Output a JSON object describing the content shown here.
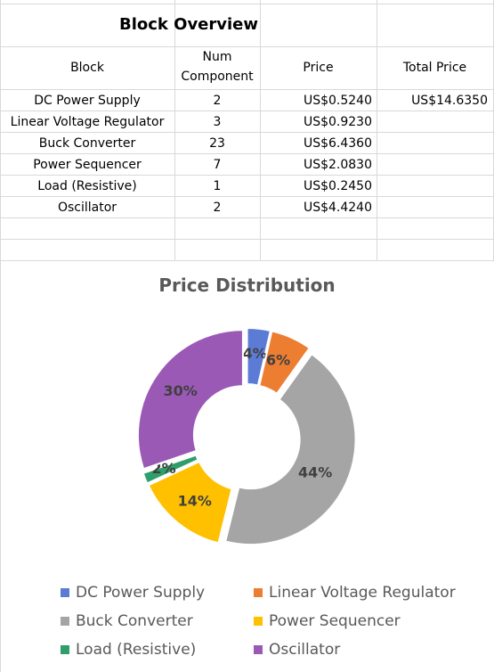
{
  "sheet": {
    "title": "Block Overview",
    "headers": {
      "block": "Block",
      "num_component_line1": "Num",
      "num_component_line2": "Component",
      "price": "Price",
      "total_price": "Total Price"
    },
    "total_price_value": "US$14.6350",
    "rows": [
      {
        "block": "DC Power Supply",
        "num": "2",
        "price": "US$0.5240"
      },
      {
        "block": "Linear Voltage Regulator",
        "num": "3",
        "price": "US$0.9230"
      },
      {
        "block": "Buck Converter",
        "num": "23",
        "price": "US$6.4360"
      },
      {
        "block": "Power Sequencer",
        "num": "7",
        "price": "US$2.0830"
      },
      {
        "block": "Load (Resistive)",
        "num": "1",
        "price": "US$0.2450"
      },
      {
        "block": "Oscillator",
        "num": "2",
        "price": "US$4.4240"
      }
    ]
  },
  "chart_data": {
    "type": "pie",
    "title": "Price Distribution",
    "categories": [
      "DC Power Supply",
      "Linear Voltage Regulator",
      "Buck Converter",
      "Power Sequencer",
      "Load (Resistive)",
      "Oscillator"
    ],
    "values": [
      0.524,
      0.923,
      6.436,
      2.083,
      0.245,
      4.424
    ],
    "labels": [
      "4%",
      "6%",
      "44%",
      "14%",
      "2%",
      "30%"
    ],
    "colors": [
      "#5b7bd5",
      "#ed7d31",
      "#a5a5a5",
      "#ffc000",
      "#2e9e6b",
      "#9b59b6"
    ],
    "style": "doughnut, exploded slices",
    "legend_position": "bottom"
  }
}
